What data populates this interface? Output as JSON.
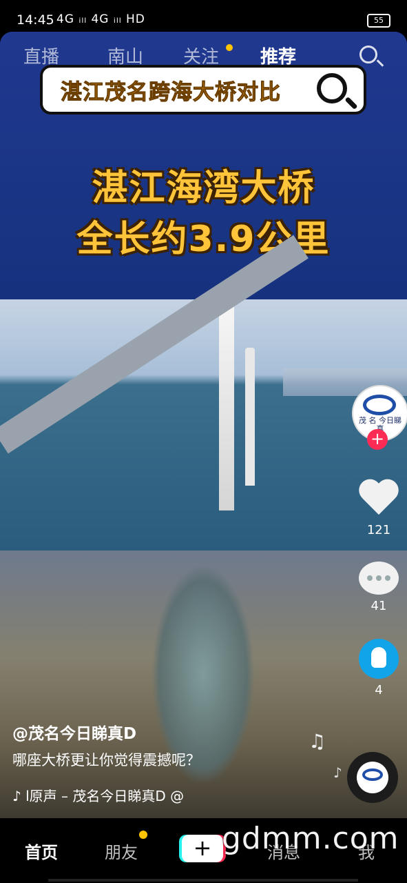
{
  "status_bar": {
    "time": "14:45",
    "network": "4G ᵢₗₗ 4G ᵢₗₗ HD",
    "battery": "55"
  },
  "top_tabs": {
    "live": "直播",
    "local": "南山",
    "follow": "关注",
    "recommend": "推荐"
  },
  "video_overlay": {
    "banner": "湛江茂名跨海大桥对比",
    "headline_line1": "湛江海湾大桥",
    "headline_line2": "全长约3.9公里"
  },
  "avatar": {
    "logo_text": "茂 名\n今日睇真"
  },
  "actions": {
    "likes": "121",
    "comments": "41",
    "shares": "4"
  },
  "post": {
    "author": "@茂名今日睇真D",
    "description": "哪座大桥更让你觉得震撼呢？",
    "music": "♪ l原声 – 茂名今日睇真D    @"
  },
  "bottom_nav": {
    "home": "首页",
    "friends": "朋友",
    "messages": "消息",
    "me": "我"
  },
  "watermark": "gdmm.com",
  "colors": {
    "accent_red": "#fe2c55",
    "accent_cyan": "#25f4ee",
    "dot_yellow": "#ffc400",
    "headline": "#ffc43a"
  }
}
